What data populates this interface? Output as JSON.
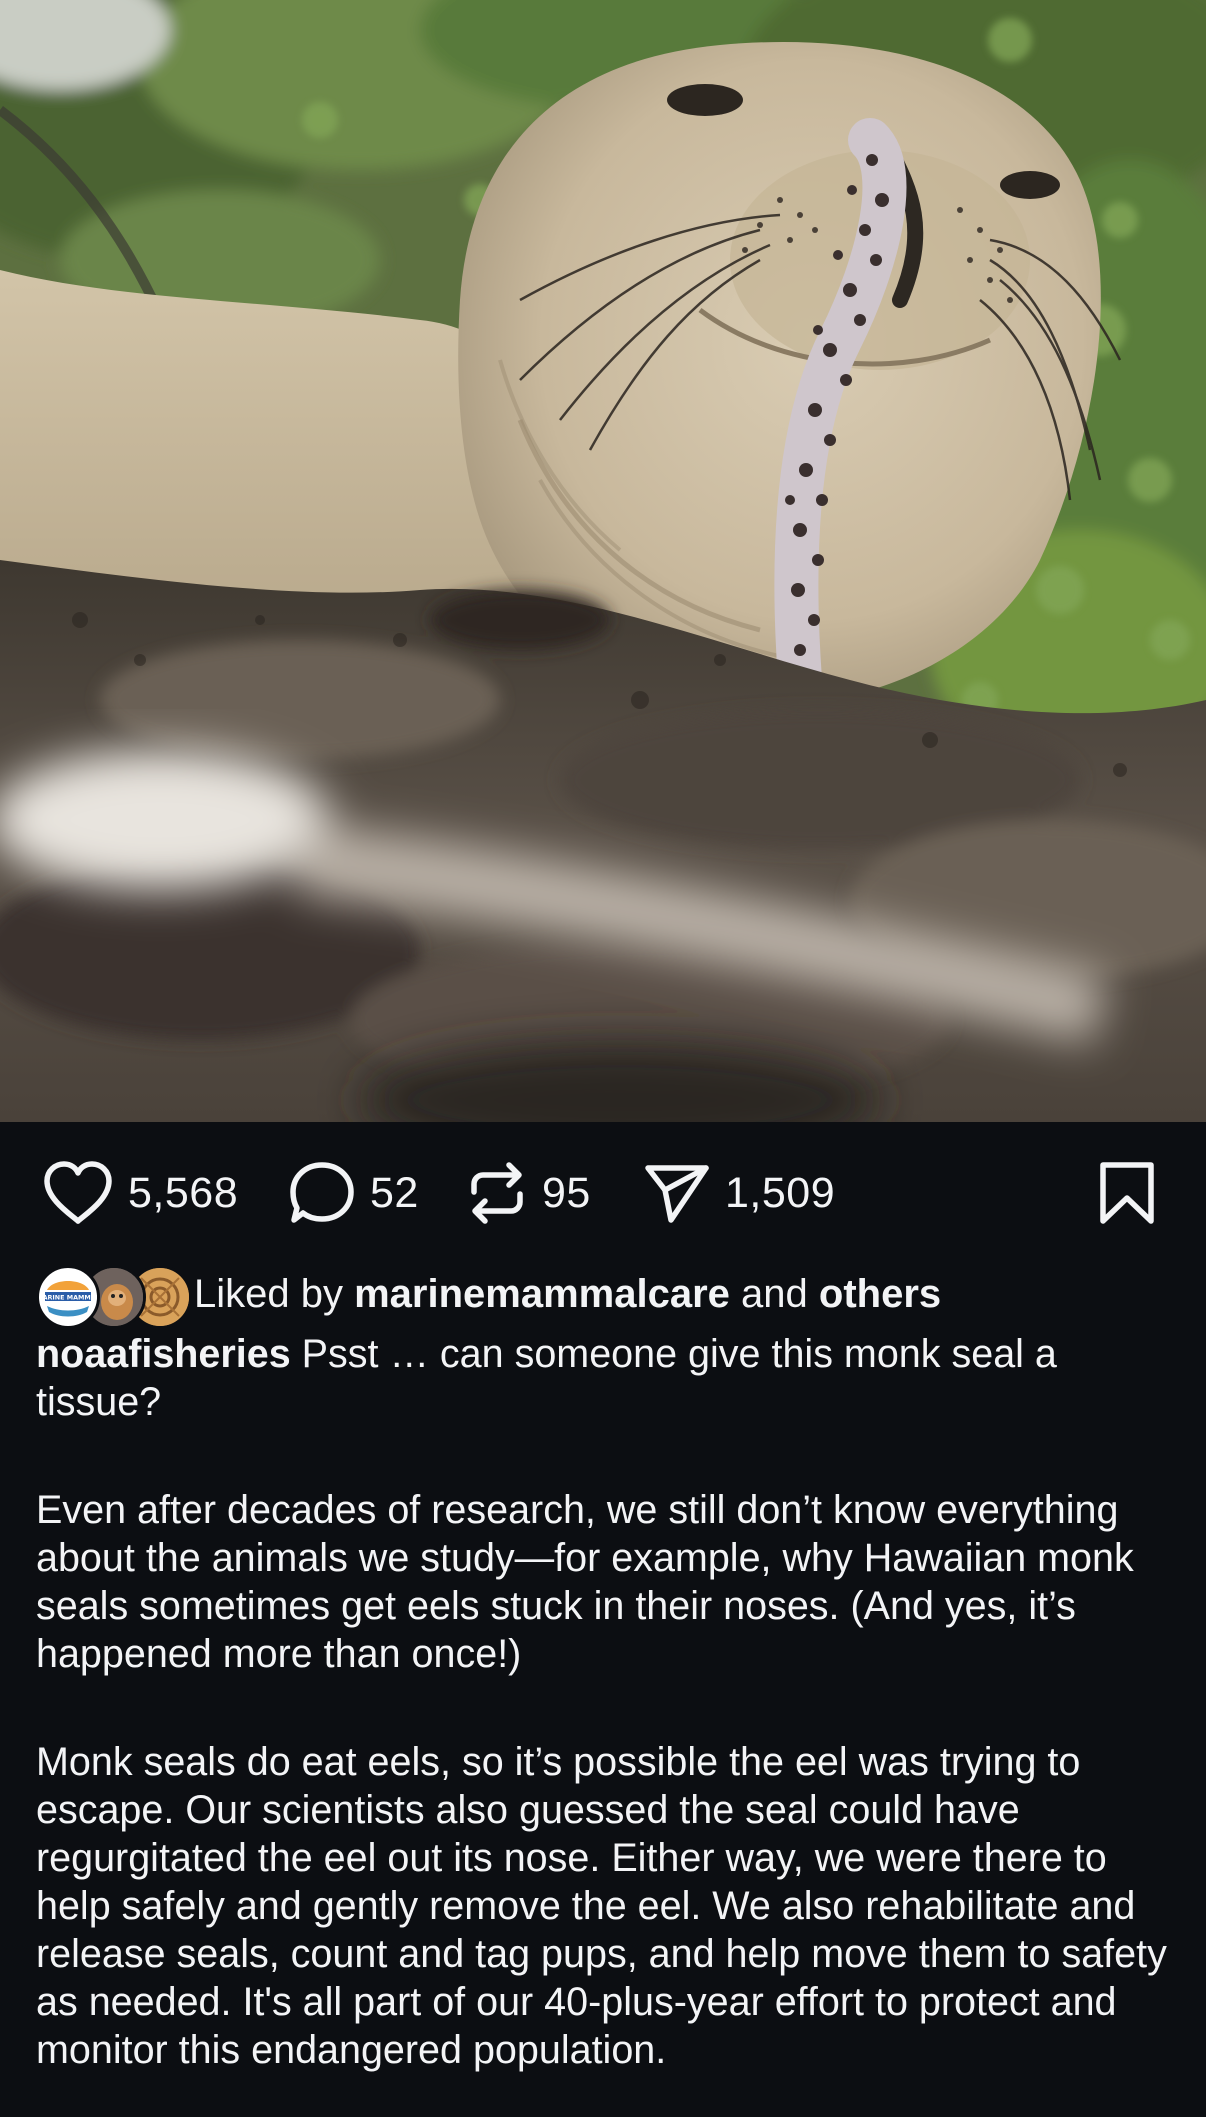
{
  "photo": {
    "subject": "Hawaiian monk seal with an eel stuck in its nose"
  },
  "actions": {
    "like_count": "5,568",
    "comment_count": "52",
    "repost_count": "95",
    "share_count": "1,509"
  },
  "liked_by": {
    "prefix": "Liked by",
    "user": "marinemammalcare",
    "conjunction": "and",
    "others": "others",
    "avatar_logo_text": "MARINE MAMMAL"
  },
  "caption": {
    "username": "noaafisheries",
    "lead": "Psst … can someone give this monk seal a tissue?",
    "paragraphs": [
      "Even after decades of research, we still don’t know everything about the animals we study—for example, why Hawaiian monk seals sometimes get eels stuck in their noses. (And yes, it’s happened more than once!)",
      "Monk seals do eat eels, so it’s possible the eel was trying to escape. Our scientists also guessed the seal could have regurgitated the eel out its nose. Either way, we were there to help safely and gently remove the eel. We also rehabilitate and release seals, count and tag pups, and help move them to safety as needed. It's all part of our 40-plus-year effort to protect and monitor this endangered population."
    ]
  },
  "colors": {
    "background": "#0c0e12",
    "text": "#f3f4f6"
  },
  "icons": [
    "heart-icon",
    "comment-icon",
    "repost-icon",
    "share-icon",
    "bookmark-icon"
  ]
}
